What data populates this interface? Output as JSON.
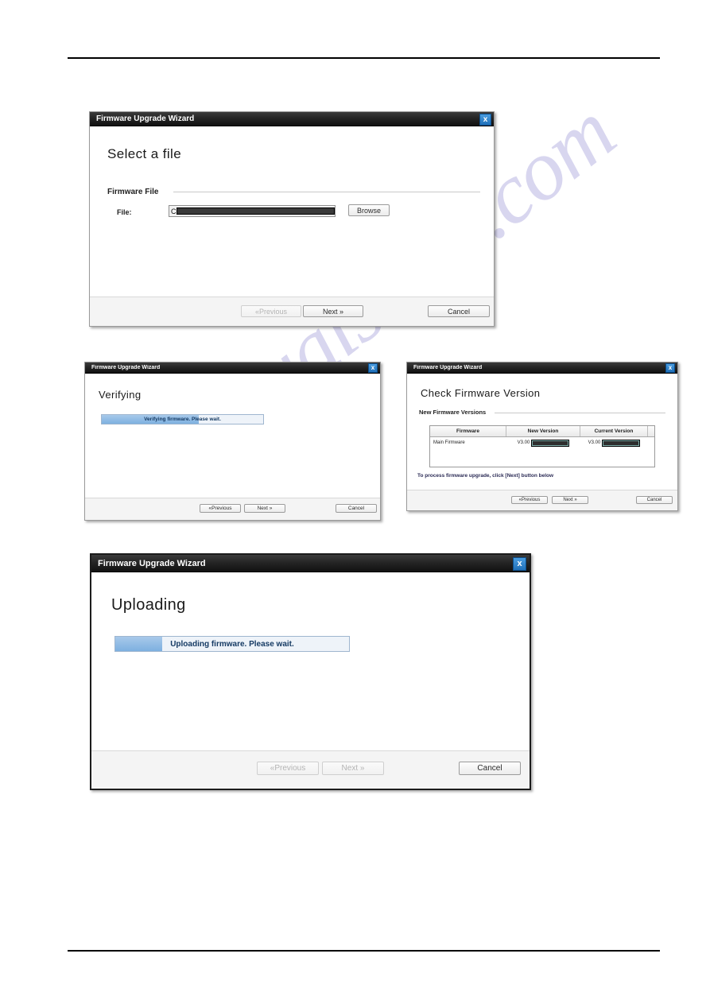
{
  "page": {
    "watermark_text": "manualshive.com"
  },
  "dialogs": {
    "select_file": {
      "title": "Firmware Upgrade Wizard",
      "close_label": "x",
      "heading": "Select a file",
      "section_label": "Firmware File",
      "file_label": "File:",
      "file_value": "C",
      "file_placeholder": "",
      "browse_label": "Browse",
      "previous_label": "«Previous",
      "next_label": "Next »",
      "cancel_label": "Cancel"
    },
    "verifying": {
      "title": "Firmware Upgrade Wizard",
      "close_label": "x",
      "heading": "Verifying",
      "progress_text": "Verifying firmware. Please wait.",
      "progress_percent": 60,
      "previous_label": "«Previous",
      "next_label": "Next »",
      "cancel_label": "Cancel"
    },
    "check_version": {
      "title": "Firmware Upgrade Wizard",
      "close_label": "x",
      "heading": "Check Firmware Version",
      "section_label": "New Firmware Versions",
      "table": {
        "columns": [
          "Firmware",
          "New Version",
          "Current Version",
          ""
        ],
        "rows": [
          {
            "firmware": "Main Firmware",
            "new_version": "V3.00",
            "current_version": "V3.00"
          }
        ]
      },
      "note": "To process firmware upgrade, click [Next] button below",
      "previous_label": "«Previous",
      "next_label": "Next »",
      "cancel_label": "Cancel"
    },
    "uploading": {
      "title": "Firmware Upgrade Wizard",
      "close_label": "x",
      "heading": "Uploading",
      "progress_text": "Uploading firmware. Please wait.",
      "progress_percent": 20,
      "previous_label": "«Previous",
      "next_label": "Next »",
      "cancel_label": "Cancel"
    }
  }
}
